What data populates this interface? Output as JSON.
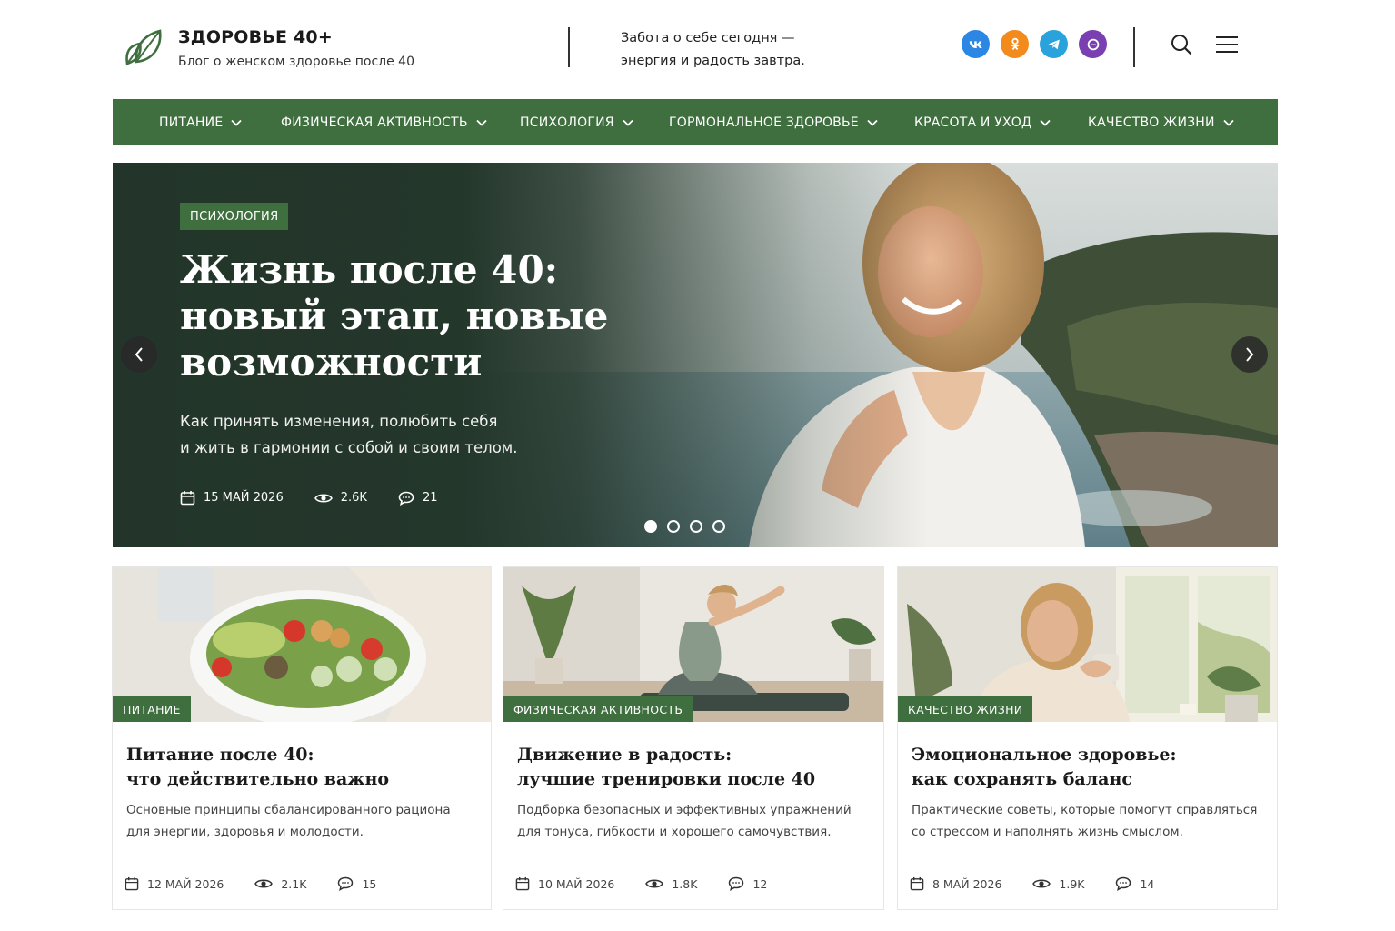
{
  "header": {
    "brand_title": "ЗДОРОВЬЕ 40+",
    "brand_subtitle": "Блог о женском здоровье после 40",
    "slogan_line1": "Забота о себе сегодня —",
    "slogan_line2": "энергия и радость завтра.",
    "social": [
      {
        "name": "vk-icon",
        "label": "vk",
        "color": "#2b87e3"
      },
      {
        "name": "ok-icon",
        "label": "ok",
        "color": "#f28a1c"
      },
      {
        "name": "telegram-icon",
        "label": "tg",
        "color": "#2aa3dd"
      },
      {
        "name": "max-icon",
        "label": "max",
        "color": "#7a3fb0"
      }
    ],
    "accent_color": "#3f6e3f"
  },
  "nav": {
    "items": [
      {
        "label": "ПИТАНИЕ"
      },
      {
        "label": "ФИЗИЧЕСКАЯ АКТИВНОСТЬ"
      },
      {
        "label": "ПСИХОЛОГИЯ"
      },
      {
        "label": "ГОРМОНАЛЬНОЕ ЗДОРОВЬЕ"
      },
      {
        "label": "КРАСОТА И УХОД"
      },
      {
        "label": "КАЧЕСТВО ЖИЗНИ"
      }
    ]
  },
  "hero": {
    "badge": "ПСИХОЛОГИЯ",
    "title": "Жизнь после 40: новый этап, новые возможности",
    "text_line1": "Как принять изменения, полюбить себя",
    "text_line2": "и жить в гармонии с собой и своим телом.",
    "date": "15 МАЙ 2026",
    "views": "2.6K",
    "comments": "21",
    "slides_total": 4,
    "active_slide": 1
  },
  "cards": [
    {
      "badge": "ПИТАНИЕ",
      "title_line1": "Питание после 40:",
      "title_line2": "что действительно важно",
      "text_line1": "Основные принципы сбалансированного рациона",
      "text_line2": "для энергии, здоровья и молодости.",
      "date": "12 МАЙ 2026",
      "views": "2.1K",
      "comments": "15"
    },
    {
      "badge": "ФИЗИЧЕСКАЯ АКТИВНОСТЬ",
      "title_line1": "Движение в радость:",
      "title_line2": "лучшие тренировки после 40",
      "text_line1": "Подборка безопасных и эффективных упражнений",
      "text_line2": "для тонуса, гибкости и хорошего самочувствия.",
      "date": "10 МАЙ 2026",
      "views": "1.8K",
      "comments": "12"
    },
    {
      "badge": "КАЧЕСТВО ЖИЗНИ",
      "title_line1": "Эмоциональное здоровье:",
      "title_line2": "как сохранять баланс",
      "text_line1": "Практические советы, которые помогут справляться",
      "text_line2": "со стрессом и наполнять жизнь смыслом.",
      "date": "8 МАЙ 2026",
      "views": "1.9K",
      "comments": "14"
    }
  ]
}
